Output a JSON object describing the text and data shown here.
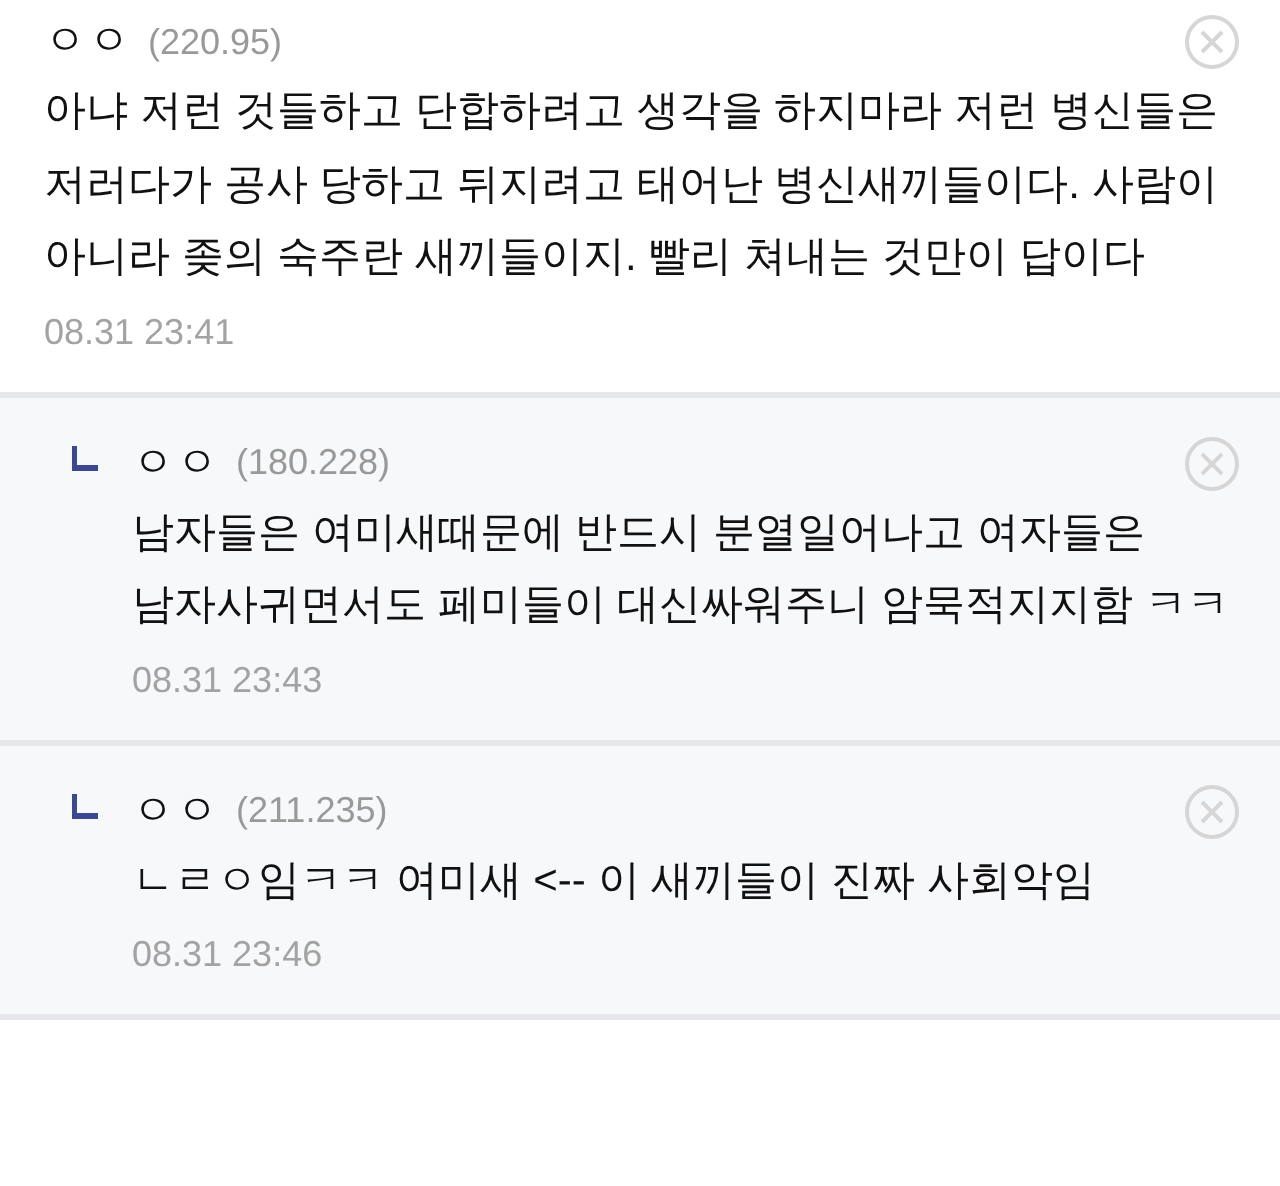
{
  "comments": [
    {
      "kind": "comment",
      "nickname": "ㅇㅇ",
      "ip": "(220.95)",
      "text": "아냐 저런 것들하고 단합하려고 생각을 하지마라 저런 병신들은 저러다가 공사 당하고 뒤지려고 태어난 병신새끼들이다. 사람이 아니라 좆의 숙주란 새끼들이지. 빨리 쳐내는 것만이 답이다",
      "time": "08.31 23:41"
    },
    {
      "kind": "reply",
      "nickname": "ㅇㅇ",
      "ip": "(180.228)",
      "text": "남자들은 여미새때문에 반드시 분열일어나고 여자들은 남자사귀면서도 페미들이 대신싸워주니 암묵적지지함 ㅋㅋ",
      "time": "08.31 23:43"
    },
    {
      "kind": "reply",
      "nickname": "ㅇㅇ",
      "ip": "(211.235)",
      "text": "ㄴㄹㅇ임ㅋㅋ 여미새 <-- 이 새끼들이 진짜 사회악임",
      "time": "08.31 23:46"
    }
  ]
}
